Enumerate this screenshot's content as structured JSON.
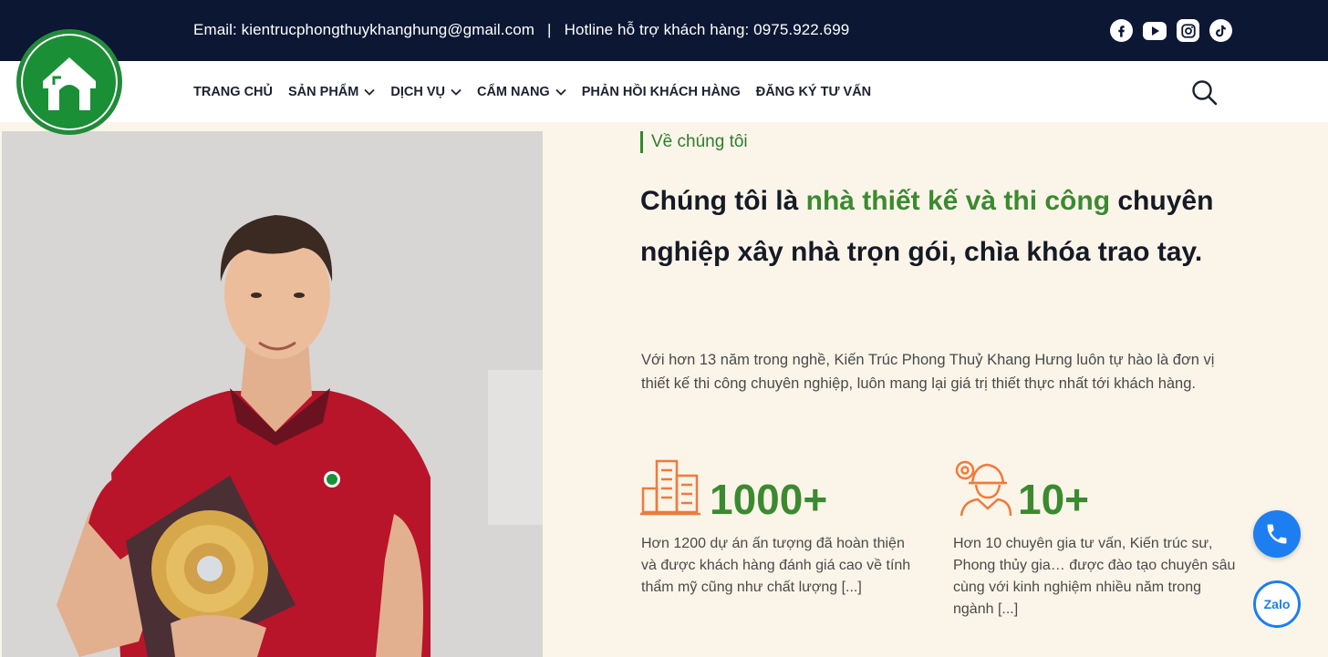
{
  "topbar": {
    "email": "Email: kientrucphongthuykhanghung@gmail.com",
    "separator": "|",
    "hotline": "Hotline hỗ trợ khách hàng: 0975.922.699",
    "social_icons": [
      "facebook-icon",
      "youtube-icon",
      "instagram-icon",
      "tiktok-icon"
    ]
  },
  "nav": {
    "items": [
      {
        "label": "TRANG CHỦ",
        "dropdown": false
      },
      {
        "label": "SẢN PHẨM",
        "dropdown": true
      },
      {
        "label": "DỊCH VỤ",
        "dropdown": true
      },
      {
        "label": "CẨM NANG",
        "dropdown": true
      },
      {
        "label": "PHẢN HỒI KHÁCH HÀNG",
        "dropdown": false
      },
      {
        "label": "ĐĂNG KÝ TƯ VẤN",
        "dropdown": false
      }
    ]
  },
  "hero": {
    "eyebrow": "Về chúng tôi",
    "headline_pre": "Chúng tôi là ",
    "headline_highlight": "nhà thiết kế và thi công",
    "headline_post": " chuyên nghiệp xây nhà trọn gói, chìa khóa trao tay.",
    "intro": "Với hơn 13 năm trong nghề, Kiến Trúc Phong Thuỷ Khang Hưng luôn tự hào là đơn vị thiết kế thi công chuyên nghiệp, luôn mang lại giá trị thiết thực nhất tới khách hàng.",
    "stats": [
      {
        "number": "1000+",
        "icon": "buildings-icon",
        "desc": "Hơn 1200 dự án ấn tượng đã hoàn thiện và được khách hàng đánh giá cao về tính thẩm mỹ cũng như chất lượng [...]"
      },
      {
        "number": "10+",
        "icon": "engineer-icon",
        "desc": "Hơn 10 chuyên gia tư vấn, Kiến trúc sư, Phong thủy gia… được đào tạo chuyên sâu cùng với kinh nghiệm nhiều năm trong ngành [...]"
      }
    ]
  },
  "floating": {
    "zalo_label": "Zalo"
  },
  "colors": {
    "topbar": "#0b1733",
    "accent_green": "#3b8a30",
    "hero_bg": "#fbf5e9",
    "call_blue": "#1c7ef0"
  }
}
